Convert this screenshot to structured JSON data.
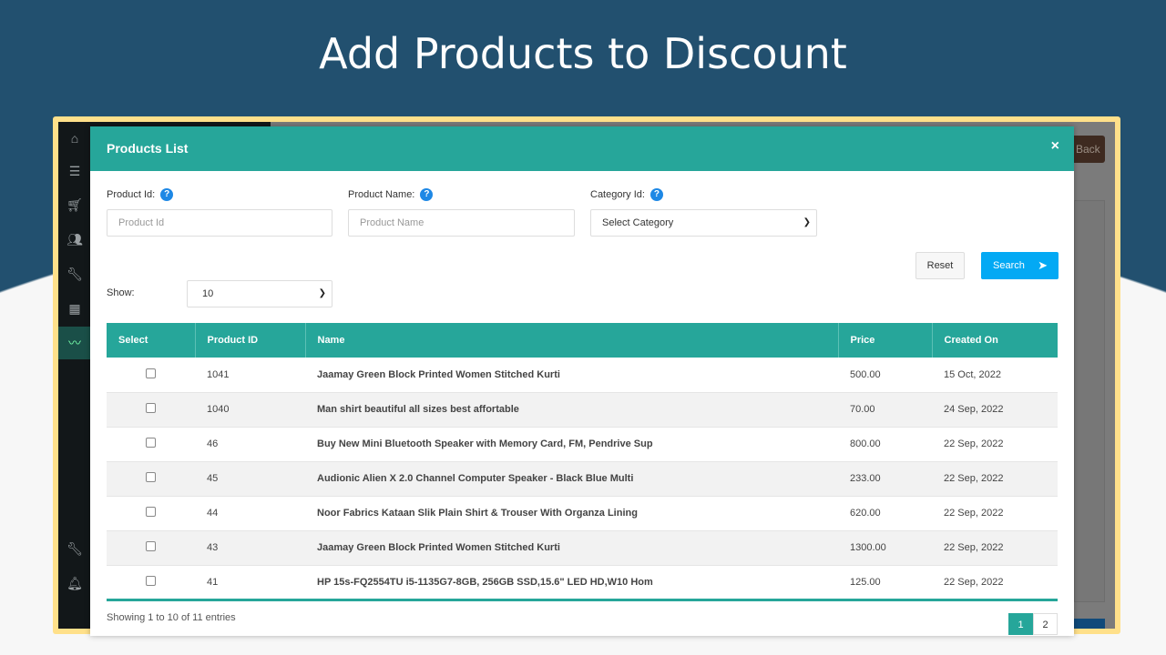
{
  "slide_title": "Add Products to Discount",
  "background_app": {
    "back_label": "Back"
  },
  "sidebar": {
    "icons": [
      "home-icon",
      "list-icon",
      "cart-icon",
      "users-icon",
      "wrench-icon",
      "grid-icon",
      "chart-icon",
      "wrench-icon",
      "bell-icon"
    ],
    "active": "chart-icon"
  },
  "modal": {
    "title": "Products List",
    "close": "×",
    "filters": {
      "product_id": {
        "label": "Product Id:",
        "placeholder": "Product Id"
      },
      "product_name": {
        "label": "Product Name:",
        "placeholder": "Product Name"
      },
      "category": {
        "label": "Category Id:",
        "value": "Select Category"
      }
    },
    "reset_label": "Reset",
    "search_label": "Search",
    "show_label": "Show:",
    "show_value": "10",
    "table": {
      "headers": [
        "Select",
        "Product ID",
        "Name",
        "Price",
        "Created On"
      ],
      "rows": [
        {
          "id": "1041",
          "name": "Jaamay Green Block Printed Women Stitched Kurti",
          "price": "500.00",
          "created": "15 Oct, 2022"
        },
        {
          "id": "1040",
          "name": "Man shirt beautiful all sizes best affortable",
          "price": "70.00",
          "created": "24 Sep, 2022"
        },
        {
          "id": "46",
          "name": "Buy New Mini Bluetooth Speaker with Memory Card, FM, Pendrive Sup",
          "price": "800.00",
          "created": "22 Sep, 2022"
        },
        {
          "id": "45",
          "name": "Audionic Alien X 2.0 Channel Computer Speaker - Black Blue Multi",
          "price": "233.00",
          "created": "22 Sep, 2022"
        },
        {
          "id": "44",
          "name": "Noor Fabrics Kataan Slik Plain Shirt & Trouser With Organza Lining",
          "price": "620.00",
          "created": "22 Sep, 2022"
        },
        {
          "id": "43",
          "name": "Jaamay Green Block Printed Women Stitched Kurti",
          "price": "1300.00",
          "created": "22 Sep, 2022"
        },
        {
          "id": "41",
          "name": "HP 15s-FQ2554TU i5-1135G7-8GB, 256GB SSD,15.6\" LED HD,W10 Hom",
          "price": "125.00",
          "created": "22 Sep, 2022"
        }
      ]
    },
    "info": "Showing 1 to 10 of 11 entries",
    "pages": [
      "1",
      "2"
    ],
    "current_page": "1",
    "colors": {
      "header": "#26a69a",
      "search": "#03a9f4",
      "frame": "#ffe08a"
    }
  }
}
